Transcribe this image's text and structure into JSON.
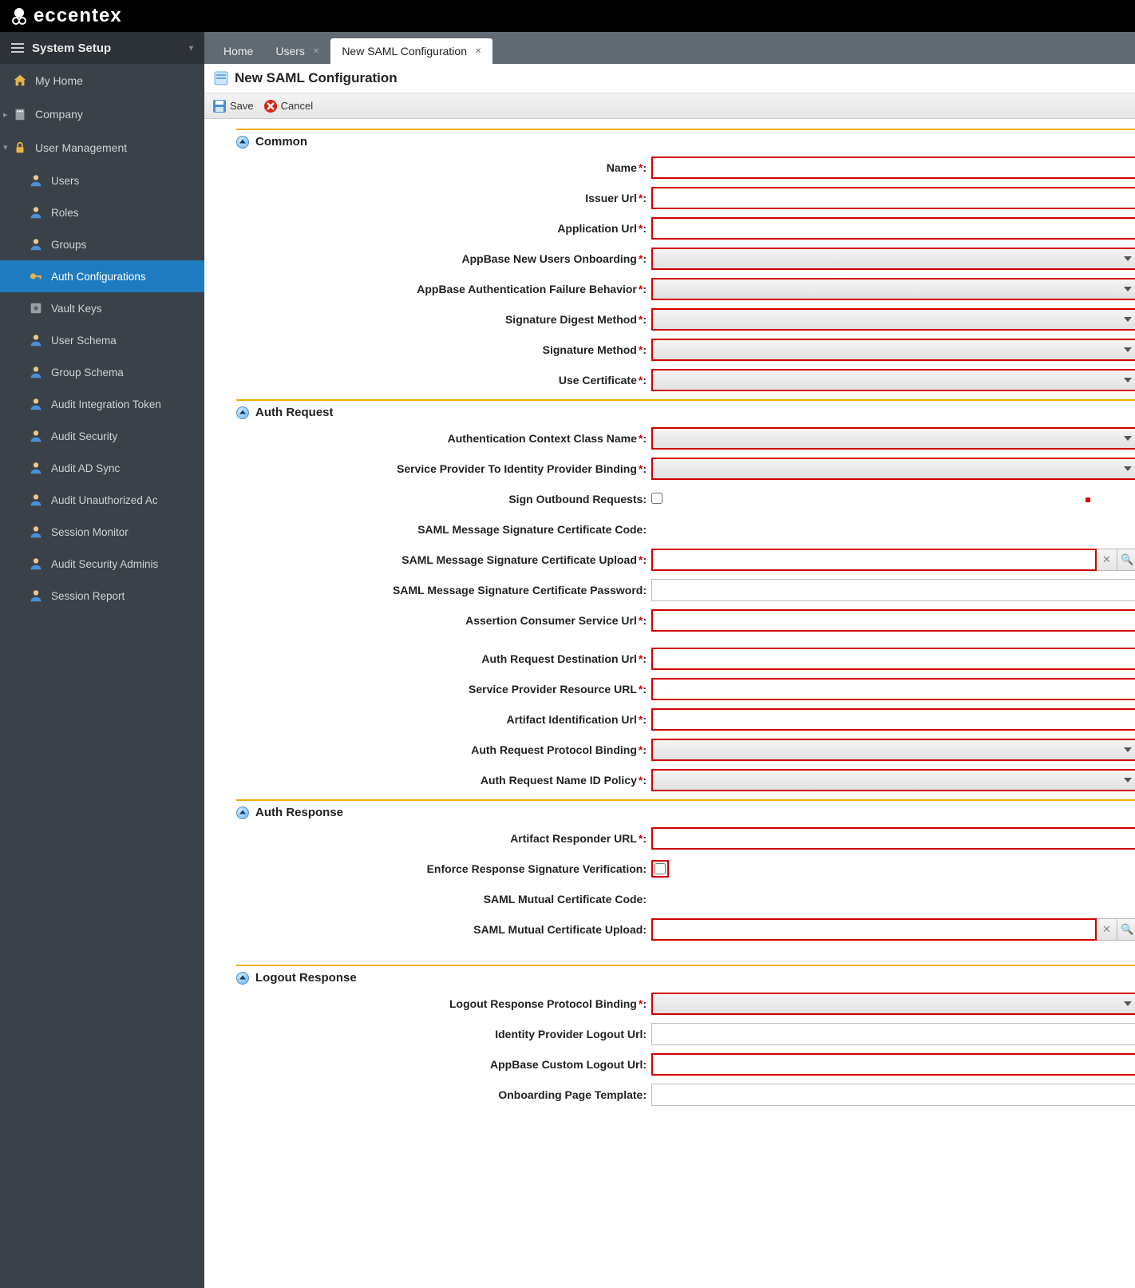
{
  "logo_text": "eccentex",
  "sidebar": {
    "header": "System Setup",
    "items": [
      {
        "label": "My Home",
        "icon": "home"
      },
      {
        "label": "Company",
        "icon": "building"
      },
      {
        "label": "User Management",
        "icon": "lock",
        "children": [
          {
            "label": "Users",
            "icon": "user"
          },
          {
            "label": "Roles",
            "icon": "user"
          },
          {
            "label": "Groups",
            "icon": "user"
          },
          {
            "label": "Auth Configurations",
            "icon": "key",
            "active": true
          },
          {
            "label": "Vault Keys",
            "icon": "vault"
          },
          {
            "label": "User Schema",
            "icon": "user"
          },
          {
            "label": "Group Schema",
            "icon": "user"
          },
          {
            "label": "Audit Integration Token",
            "icon": "user"
          },
          {
            "label": "Audit Security",
            "icon": "user"
          },
          {
            "label": "Audit AD Sync",
            "icon": "user"
          },
          {
            "label": "Audit Unauthorized Ac",
            "icon": "user"
          },
          {
            "label": "Session Monitor",
            "icon": "user"
          },
          {
            "label": "Audit Security Adminis",
            "icon": "user"
          },
          {
            "label": "Session Report",
            "icon": "user"
          }
        ]
      }
    ]
  },
  "tabs": [
    {
      "label": "Home",
      "closable": false
    },
    {
      "label": "Users",
      "closable": true
    },
    {
      "label": "New SAML Configuration",
      "closable": true,
      "active": true
    }
  ],
  "page_title": "New SAML Configuration",
  "toolbar": {
    "save": "Save",
    "cancel": "Cancel"
  },
  "sections": {
    "common": {
      "title": "Common",
      "fields": {
        "name": "Name",
        "issuer": "Issuer Url",
        "appurl": "Application Url",
        "onboard": "AppBase New Users Onboarding",
        "failbeh": "AppBase Authentication Failure Behavior",
        "digest": "Signature Digest Method",
        "sigmethod": "Signature Method",
        "usecert": "Use Certificate"
      }
    },
    "authreq": {
      "title": "Auth Request",
      "fields": {
        "ctxclass": "Authentication Context Class Name",
        "spidp": "Service Provider To Identity Provider Binding",
        "signout": "Sign Outbound Requests:",
        "sigcode": "SAML Message Signature Certificate Code:",
        "sigupload": "SAML Message Signature Certificate Upload",
        "sigpass": "SAML Message Signature Certificate Password:",
        "acsurl": "Assertion Consumer Service Url",
        "desturl": "Auth Request Destination Url",
        "spresurl": "Service Provider Resource URL",
        "artid": "Artifact Identification Url",
        "protobind": "Auth Request Protocol Binding",
        "nameid": "Auth Request Name ID Policy"
      }
    },
    "authresp": {
      "title": "Auth Response",
      "fields": {
        "artresp": "Artifact Responder URL",
        "enforce": "Enforce Response Signature Verification:",
        "mutcode": "SAML Mutual Certificate Code:",
        "mutupload": "SAML Mutual Certificate Upload:"
      }
    },
    "logout": {
      "title": "Logout Response",
      "fields": {
        "protobind": "Logout Response Protocol Binding",
        "idplogout": "Identity Provider Logout Url:",
        "appbaselogout": "AppBase Custom Logout Url:",
        "onboardtpl": "Onboarding Page Template:"
      }
    }
  }
}
